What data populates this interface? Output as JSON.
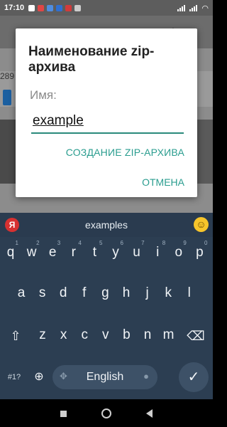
{
  "status_bar": {
    "time": "17:10",
    "battery_icon": "battery-icon",
    "wifi_icon": "wifi-icon"
  },
  "app_behind": {
    "partial_number": "289"
  },
  "dialog": {
    "title": "Наименование zip-архива",
    "name_label": "Имя:",
    "name_value": "example",
    "create_button": "СОЗДАНИЕ ZIP-АРХИВА",
    "cancel_button": "ОТМЕНА",
    "accent_color": "#2a9d8f"
  },
  "keyboard": {
    "brand_logo": "Я",
    "suggestion": "examples",
    "emoji_icon": "emoji-icon",
    "row1": [
      "q",
      "w",
      "e",
      "r",
      "t",
      "y",
      "u",
      "i",
      "o",
      "p"
    ],
    "row1_hints": [
      "1",
      "2",
      "3",
      "4",
      "5",
      "6",
      "7",
      "8",
      "9",
      "0"
    ],
    "row2": [
      "a",
      "s",
      "d",
      "f",
      "g",
      "h",
      "j",
      "k",
      "l"
    ],
    "row3": [
      "z",
      "x",
      "c",
      "v",
      "b",
      "n",
      "m"
    ],
    "symbols_key": "#1?",
    "space_label": "English",
    "background_color": "#2c3e52"
  },
  "nav_bar": {
    "recents": "recents-icon",
    "home": "home-icon",
    "back": "back-icon"
  }
}
